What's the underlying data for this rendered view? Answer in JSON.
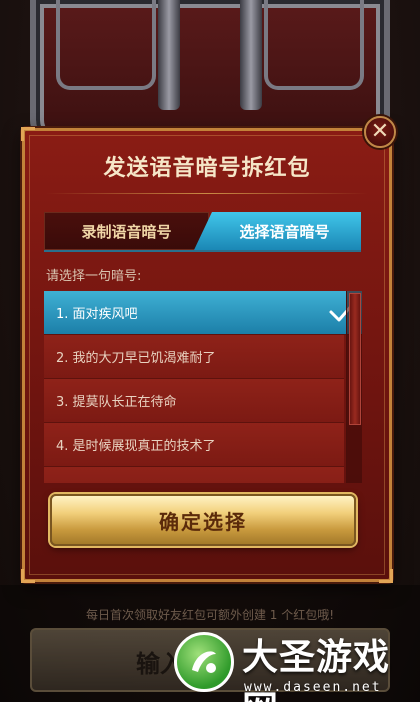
{
  "modal": {
    "title": "发送语音暗号拆红包",
    "close_icon": "close-icon",
    "tabs": [
      {
        "label": "录制语音暗号",
        "active": false
      },
      {
        "label": "选择语音暗号",
        "active": true
      }
    ],
    "prompt": "请选择一句暗号:",
    "phrases": [
      {
        "label": "1. 面对疾风吧",
        "selected": true
      },
      {
        "label": "2. 我的大刀早已饥渴难耐了",
        "selected": false
      },
      {
        "label": "3. 提莫队长正在待命",
        "selected": false
      },
      {
        "label": "4. 是时候展现真正的技术了",
        "selected": false
      }
    ],
    "confirm_label": "确定选择"
  },
  "background": {
    "notice": "每日首次领取好友红包可额外创建 1 个红包哦!",
    "input_button_label": "输入"
  },
  "watermark": {
    "title": "大圣游戏网",
    "url": "www.daseen.net"
  },
  "colors": {
    "modal_bg": "#7c1a13",
    "accent_blue": "#1c7fa8",
    "gold": "#f2d07c",
    "border_gold": "#c2823a"
  }
}
